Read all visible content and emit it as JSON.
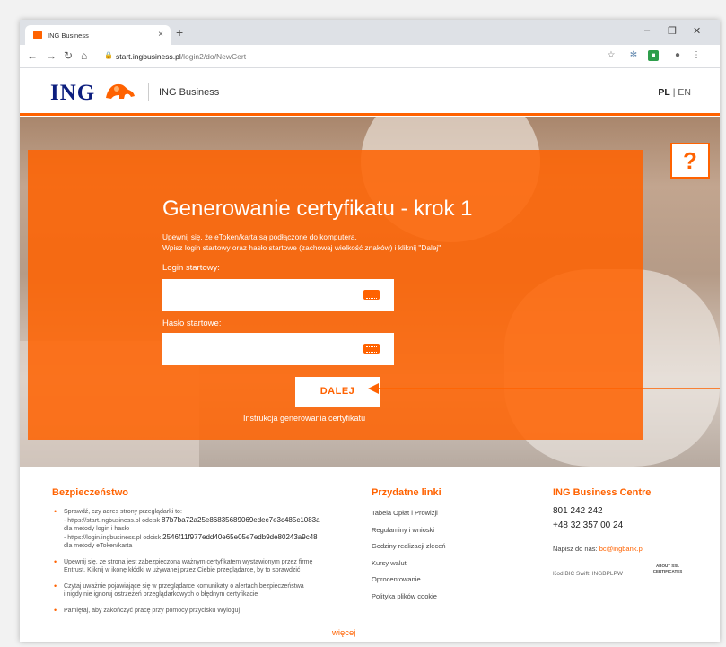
{
  "browser": {
    "tab_title": "ING Business",
    "new_tab": "+",
    "tab_close": "×",
    "url_host": "start.ingbusiness.pl",
    "url_path": "/login2/do/NewCert"
  },
  "header": {
    "logo_text": "ING",
    "app_name": "ING Business",
    "lang_pl": "PL",
    "lang_sep": "|",
    "lang_en": "EN"
  },
  "form": {
    "title": "Generowanie certyfikatu - krok 1",
    "hint_line1": "Upewnij się, że eToken/karta są podłączone do komputera.",
    "hint_line2": "Wpisz login startowy oraz hasło startowe (zachowaj wielkość znaków) i kliknij \"Dalej\".",
    "login_label": "Login startowy:",
    "login_value": "",
    "password_label": "Hasło startowe:",
    "password_value": "",
    "next_button": "DALEJ",
    "instructions_link": "Instrukcja generowania certyfikatu",
    "help_button": "?"
  },
  "footer": {
    "security": {
      "title": "Bezpieczeństwo",
      "check_intro": "Sprawdź, czy adres strony przeglądarki to:",
      "url1": "- https://start.ingbusiness.pl odcisk",
      "hash1": "87b7ba72a25e86835689069edec7e3c485c1083a",
      "url1_note": "dla metody login i hasło",
      "url2": "- https://login.ingbusiness.pl odcisk",
      "hash2": "2546f11f977edd40e65e05e7edb9de80243a9c48",
      "url2_note": "dla metody eToken/karta",
      "item2_line1": "Upewnij się, że strona jest zabezpieczona ważnym certyfikatem wystawionym przez firmę",
      "item2_line2": "Entrust. Kliknij w ikonę kłódki w używanej przez Ciebie przeglądarce, by to sprawdzić",
      "item3_line1": "Czytaj uważnie pojawiające się w przeglądarce komunikaty o alertach bezpieczeństwa",
      "item3_line2": "i nigdy nie ignoruj ostrzeżeń przeglądarkowych o błędnym certyfikacie",
      "item4": "Pamiętaj, aby zakończyć pracę przy pomocy przycisku Wyloguj",
      "more": "więcej"
    },
    "links": {
      "title": "Przydatne linki",
      "items": [
        "Tabela Opłat i Prowizji",
        "Regulaminy i wnioski",
        "Godziny realizacji zleceń",
        "Kursy walut",
        "Oprocentowanie",
        "Polityka plików cookie"
      ]
    },
    "centre": {
      "title": "ING Business Centre",
      "phone1": "801 242 242",
      "phone2": "+48 32 357 00 24",
      "mail_label": "Napisz do nas:",
      "mail": "bc@ingbank.pl",
      "swift": "Kod BIC Swift: INGBPLPW",
      "ssl_badge": "ABOUT SSL CERTIFICATES"
    }
  },
  "colors": {
    "accent": "#ff6200",
    "logo_navy": "#0c1e7e"
  }
}
